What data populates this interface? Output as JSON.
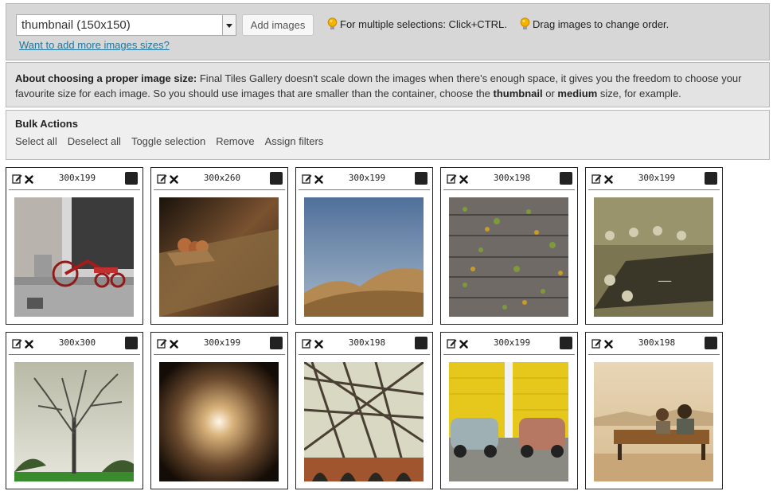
{
  "toolbar": {
    "size_select": "thumbnail (150x150)",
    "add_images_label": "Add images",
    "tip_multi": "For multiple selections: Click+CTRL.",
    "tip_drag": "Drag images to change order.",
    "more_sizes_link": "Want to add more images sizes?"
  },
  "about": {
    "title": "About choosing a proper image size:",
    "text_1": " Final Tiles Gallery doesn't scale down the images when there's enough space, it gives you the freedom to choose your favourite size for each image. So you should use images that are smaller than the container, choose the ",
    "thumbnail": "thumbnail",
    "or": " or ",
    "medium": "medium",
    "text_2": " size, for example."
  },
  "bulk": {
    "title": "Bulk Actions",
    "actions": [
      "Select all",
      "Deselect all",
      "Toggle selection",
      "Remove",
      "Assign filters"
    ]
  },
  "images": [
    {
      "dims": "300x199",
      "subject": "tricycle"
    },
    {
      "dims": "300x260",
      "subject": "wooden-toy"
    },
    {
      "dims": "300x199",
      "subject": "desert-hills"
    },
    {
      "dims": "300x198",
      "subject": "leaves-on-boards"
    },
    {
      "dims": "300x199",
      "subject": "guitar-headstock"
    },
    {
      "dims": "300x300",
      "subject": "bare-tree"
    },
    {
      "dims": "300x199",
      "subject": "tunnel"
    },
    {
      "dims": "300x198",
      "subject": "steel-structure"
    },
    {
      "dims": "300x199",
      "subject": "vintage-cars"
    },
    {
      "dims": "300x198",
      "subject": "couple-on-bench"
    }
  ],
  "colors": {
    "link": "#21759b",
    "bulb": "#f0b000"
  }
}
